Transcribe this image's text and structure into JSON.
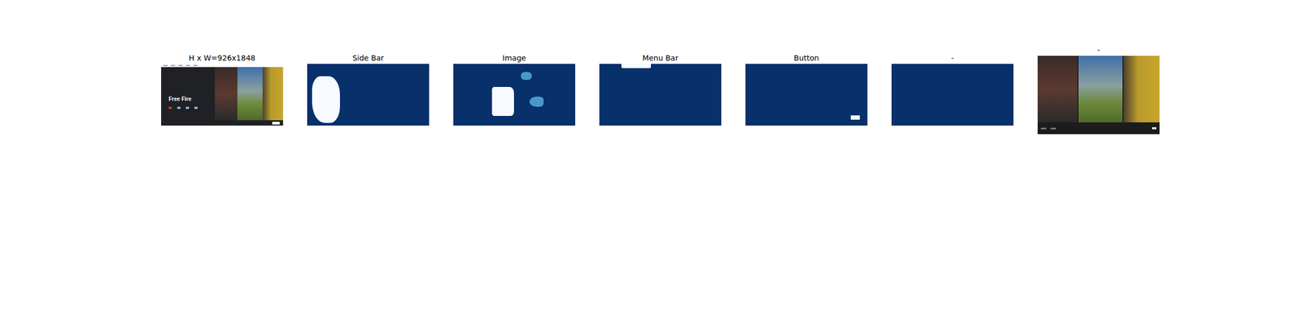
{
  "panels": [
    {
      "title": "H x W=926x1848",
      "kind": "screenshot",
      "screen": {
        "app_title": "Free Fire"
      }
    },
    {
      "title": "Side Bar",
      "kind": "mask"
    },
    {
      "title": "Image",
      "kind": "mask"
    },
    {
      "title": "Menu Bar",
      "kind": "mask"
    },
    {
      "title": "Button",
      "kind": "mask"
    },
    {
      "title": "-",
      "kind": "mask"
    },
    {
      "title": "-",
      "kind": "photo"
    }
  ]
}
